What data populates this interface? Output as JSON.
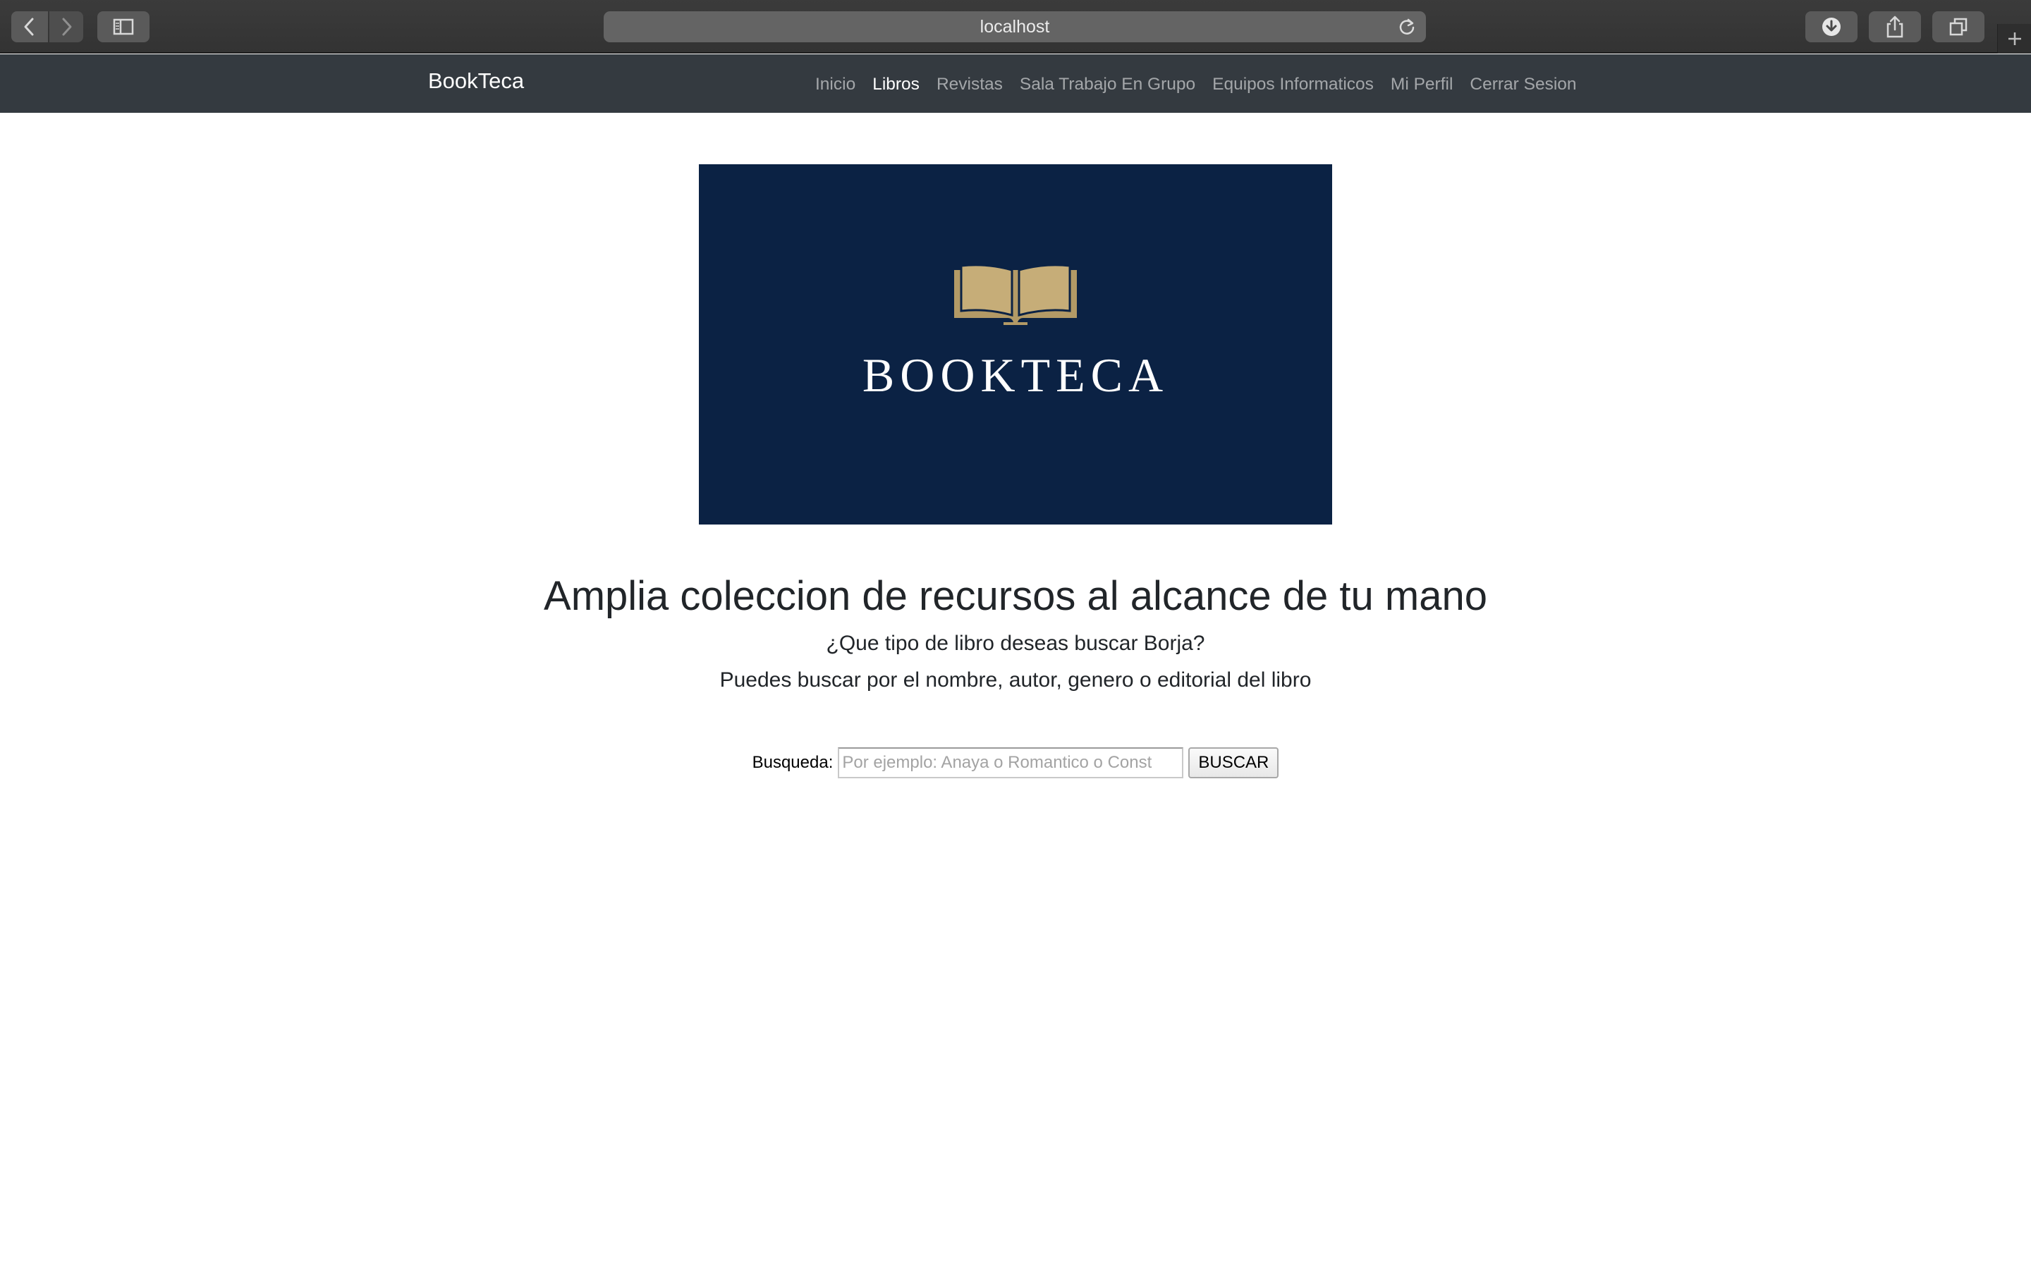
{
  "browser": {
    "url": "localhost",
    "icons": {
      "back": "chevron-left-icon",
      "forward": "chevron-right-icon",
      "sidebar": "sidebar-icon",
      "reload": "reload-icon",
      "download": "download-icon",
      "share": "share-icon",
      "tabs": "tabs-overview-icon",
      "new_tab": "plus-icon"
    }
  },
  "navbar": {
    "brand": "BookTeca",
    "links": [
      {
        "label": "Inicio",
        "active": false
      },
      {
        "label": "Libros",
        "active": true
      },
      {
        "label": "Revistas",
        "active": false
      },
      {
        "label": "Sala Trabajo En Grupo",
        "active": false
      },
      {
        "label": "Equipos Informaticos",
        "active": false
      },
      {
        "label": "Mi Perfil",
        "active": false
      },
      {
        "label": "Cerrar Sesion",
        "active": false
      }
    ],
    "background": "#343a40"
  },
  "hero": {
    "logo_text": "BOOKTECA",
    "logo_background": "#0b2244",
    "logo_accent": "#b39a66"
  },
  "main": {
    "headline": "Amplia coleccion de recursos al alcance de tu mano",
    "question": "¿Que tipo de libro deseas buscar Borja?",
    "hint": "Puedes buscar por el nombre, autor, genero o editorial del libro"
  },
  "search": {
    "label": "Busqueda:",
    "placeholder": "Por ejemplo: Anaya o Romantico o Const",
    "value": "",
    "button_label": "BUSCAR"
  }
}
